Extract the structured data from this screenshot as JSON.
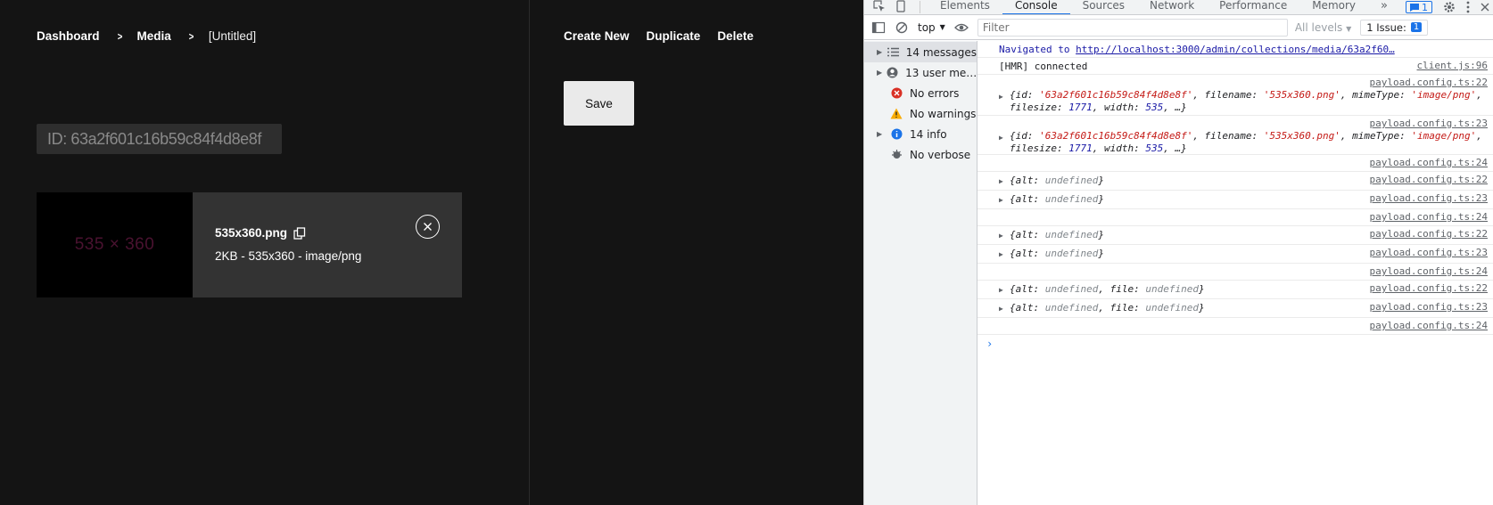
{
  "app": {
    "breadcrumb": [
      "Dashboard",
      "Media",
      "[Untitled]"
    ],
    "id_label": "ID: 63a2f601c16b59c84f4d8e8f",
    "file": {
      "thumb_text": "535 × 360",
      "name": "535x360.png",
      "details": "2KB - 535x360 - image/png"
    },
    "actions": [
      "Create New",
      "Duplicate",
      "Delete"
    ],
    "save_label": "Save"
  },
  "devtools": {
    "tabs": [
      "Elements",
      "Console",
      "Sources",
      "Network",
      "Performance",
      "Memory"
    ],
    "active_tab": "Console",
    "more": "»",
    "message_badge": "1",
    "context": "top",
    "filter_placeholder": "Filter",
    "levels": "All levels",
    "issues": {
      "label": "1 Issue:",
      "count": "1"
    },
    "sidebar": [
      {
        "label": "14 messages",
        "icon": "list-icon",
        "expandable": true
      },
      {
        "label": "13 user me…",
        "icon": "user-icon",
        "expandable": true
      },
      {
        "label": "No errors",
        "icon": "error-icon",
        "expandable": false
      },
      {
        "label": "No warnings",
        "icon": "warning-icon",
        "expandable": false
      },
      {
        "label": "14 info",
        "icon": "info-icon",
        "expandable": true
      },
      {
        "label": "No verbose",
        "icon": "verbose-icon",
        "expandable": false
      }
    ],
    "console": {
      "navigated_prefix": "Navigated to ",
      "navigated_url": "http://localhost:3000/admin/collections/media/63a2f60…",
      "hmr": "[HMR] connected",
      "hmr_src": "client.js:96",
      "src22": "payload.config.ts:22",
      "src23": "payload.config.ts:23",
      "src24": "payload.config.ts:24",
      "obj_id": "'63a2f601c16b59c84f4d8e8f'",
      "obj_filename": "'535x360.png'",
      "obj_mime": "'image/png'",
      "obj_filesize": "1771",
      "obj_width": "535",
      "undefined": "undefined"
    },
    "colors": {
      "accent": "#1a73e8",
      "error": "#d93025",
      "warning": "#f9ab00",
      "info": "#1a73e8"
    }
  }
}
